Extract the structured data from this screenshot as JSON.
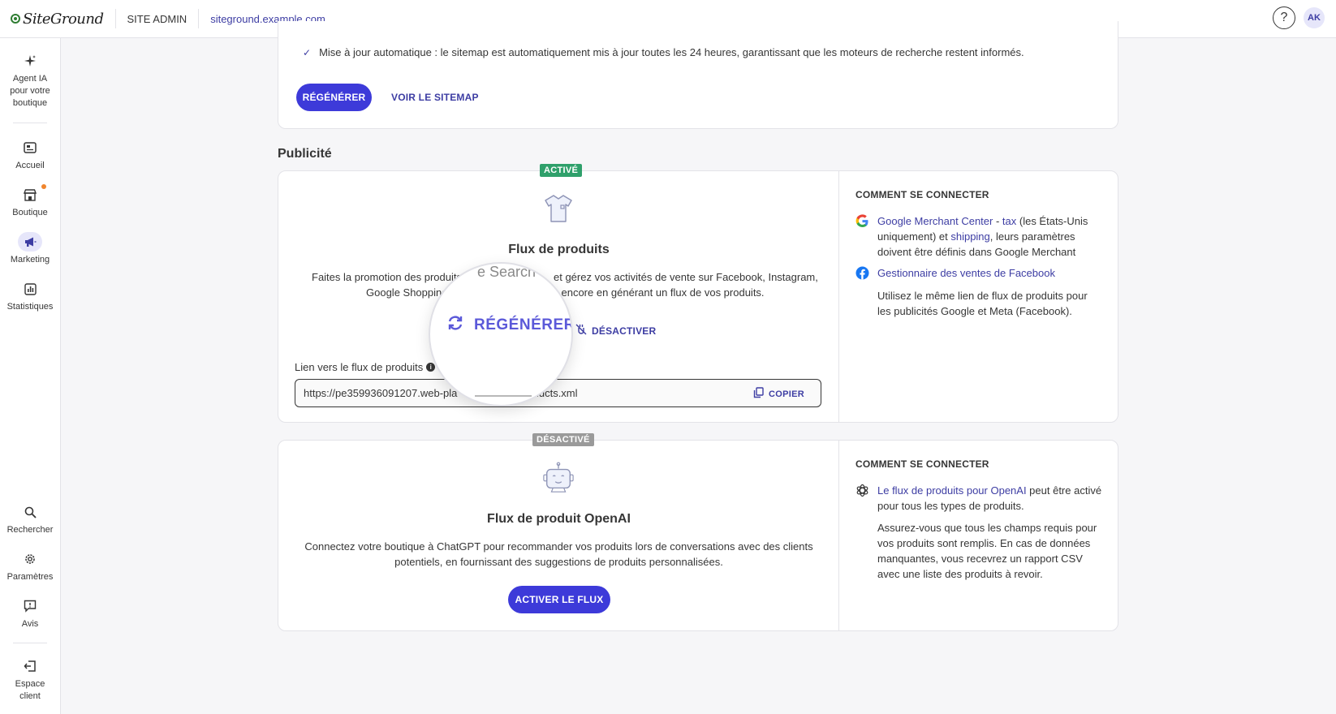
{
  "header": {
    "logo_text": "SiteGround",
    "site_admin": "SITE ADMIN",
    "domain": "siteground.example.com",
    "help_icon": "?",
    "avatar": "AK"
  },
  "sidebar": {
    "items": [
      {
        "label": "Agent IA pour votre boutique",
        "icon": "sparkle-icon"
      },
      {
        "label": "Accueil",
        "icon": "home-icon"
      },
      {
        "label": "Boutique",
        "icon": "store-icon"
      },
      {
        "label": "Marketing",
        "icon": "megaphone-icon",
        "active": true
      },
      {
        "label": "Statistiques",
        "icon": "chart-icon"
      },
      {
        "label": "Rechercher",
        "icon": "search-icon"
      },
      {
        "label": "Paramètres",
        "icon": "gear-icon"
      },
      {
        "label": "Avis",
        "icon": "feedback-icon"
      },
      {
        "label": "Espace client",
        "icon": "logout-icon"
      }
    ]
  },
  "sitemap": {
    "check_text": "Mise à jour automatique : le sitemap est automatiquement mis à jour toutes les 24 heures, garantissant que les moteurs de recherche restent informés.",
    "regen_label": "RÉGÉNÉRER",
    "view_label": "VOIR LE SITEMAP"
  },
  "publicite": {
    "title": "Publicité",
    "product_feed": {
      "badge": "ACTIVÉ",
      "title": "Flux de produits",
      "desc_line1": "Faites la promotion des produits",
      "desc_line1b": "et gérez vos activités de vente sur Facebook, Instagram,",
      "desc_line2a": "Google Shopping",
      "desc_line2b": "encore en générant un flux de vos produits.",
      "regen_label": "RÉGÉNÉRER",
      "deactivate_label": "DÉSACTIVER",
      "link_label": "Lien vers le flux de produits",
      "url_start": "https://pe359936091207.web-pla",
      "url_end": "oducts.xml",
      "copy_label": "COPIER",
      "how_title": "COMMENT SE CONNECTER",
      "google_link1": "Google Merchant Center",
      "google_dash": " - ",
      "google_link2": "tax",
      "google_text1": " (les États-Unis uniquement) et ",
      "google_link3": "shipping",
      "google_text2": ", leurs paramètres doivent être définis dans Google Merchant",
      "facebook_link": "Gestionnaire des ventes de Facebook",
      "note": "Utilisez le même lien de flux de produits pour les publicités Google et Meta (Facebook)."
    },
    "openai_feed": {
      "badge": "DÉSACTIVÉ",
      "title": "Flux de produit OpenAI",
      "desc": "Connectez votre boutique à ChatGPT pour recommander vos produits lors de conversations avec des clients potentiels, en fournissant des suggestions de produits personnalisées.",
      "activate_label": "ACTIVER LE FLUX",
      "how_title": "COMMENT SE CONNECTER",
      "openai_link": "Le flux de produits pour OpenAI",
      "openai_text": " peut être activé pour tous les types de produits.",
      "note": "Assurez-vous que tous les champs requis pour vos produits sont remplis. En cas de données manquantes, vous recevrez un rapport CSV avec une liste des produits à revoir."
    }
  },
  "magnifier": {
    "search_text": "e Search e",
    "regen_label": "RÉGÉNÉRER"
  },
  "colors": {
    "accent": "#3d3ad9",
    "link": "#3d3da3",
    "active_badge": "#2fa06b",
    "inactive_badge": "#9a9a9a"
  }
}
